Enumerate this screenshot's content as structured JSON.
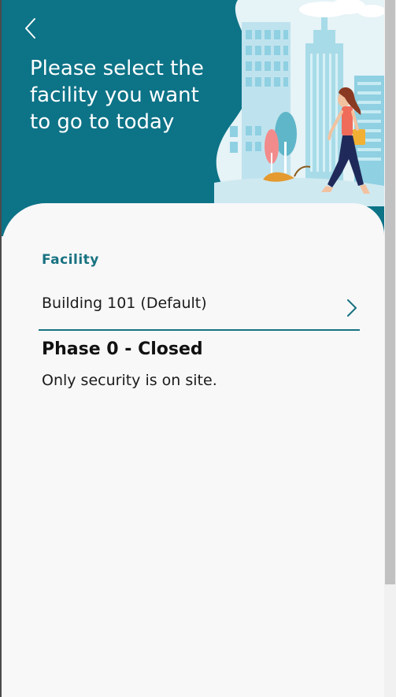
{
  "header": {
    "back_icon": "chevron-left-icon",
    "title": "Please select the facility you want to go to today",
    "illustration": "city-walker-illustration"
  },
  "facility": {
    "label": "Facility",
    "selected_value": "Building 101 (Default)",
    "chevron_icon": "chevron-right-icon"
  },
  "phase": {
    "title": "Phase 0 - Closed",
    "description": "Only security is on site."
  },
  "colors": {
    "header_bg": "#0d7387",
    "accent": "#187281",
    "card_bg": "#f8f8f8"
  }
}
